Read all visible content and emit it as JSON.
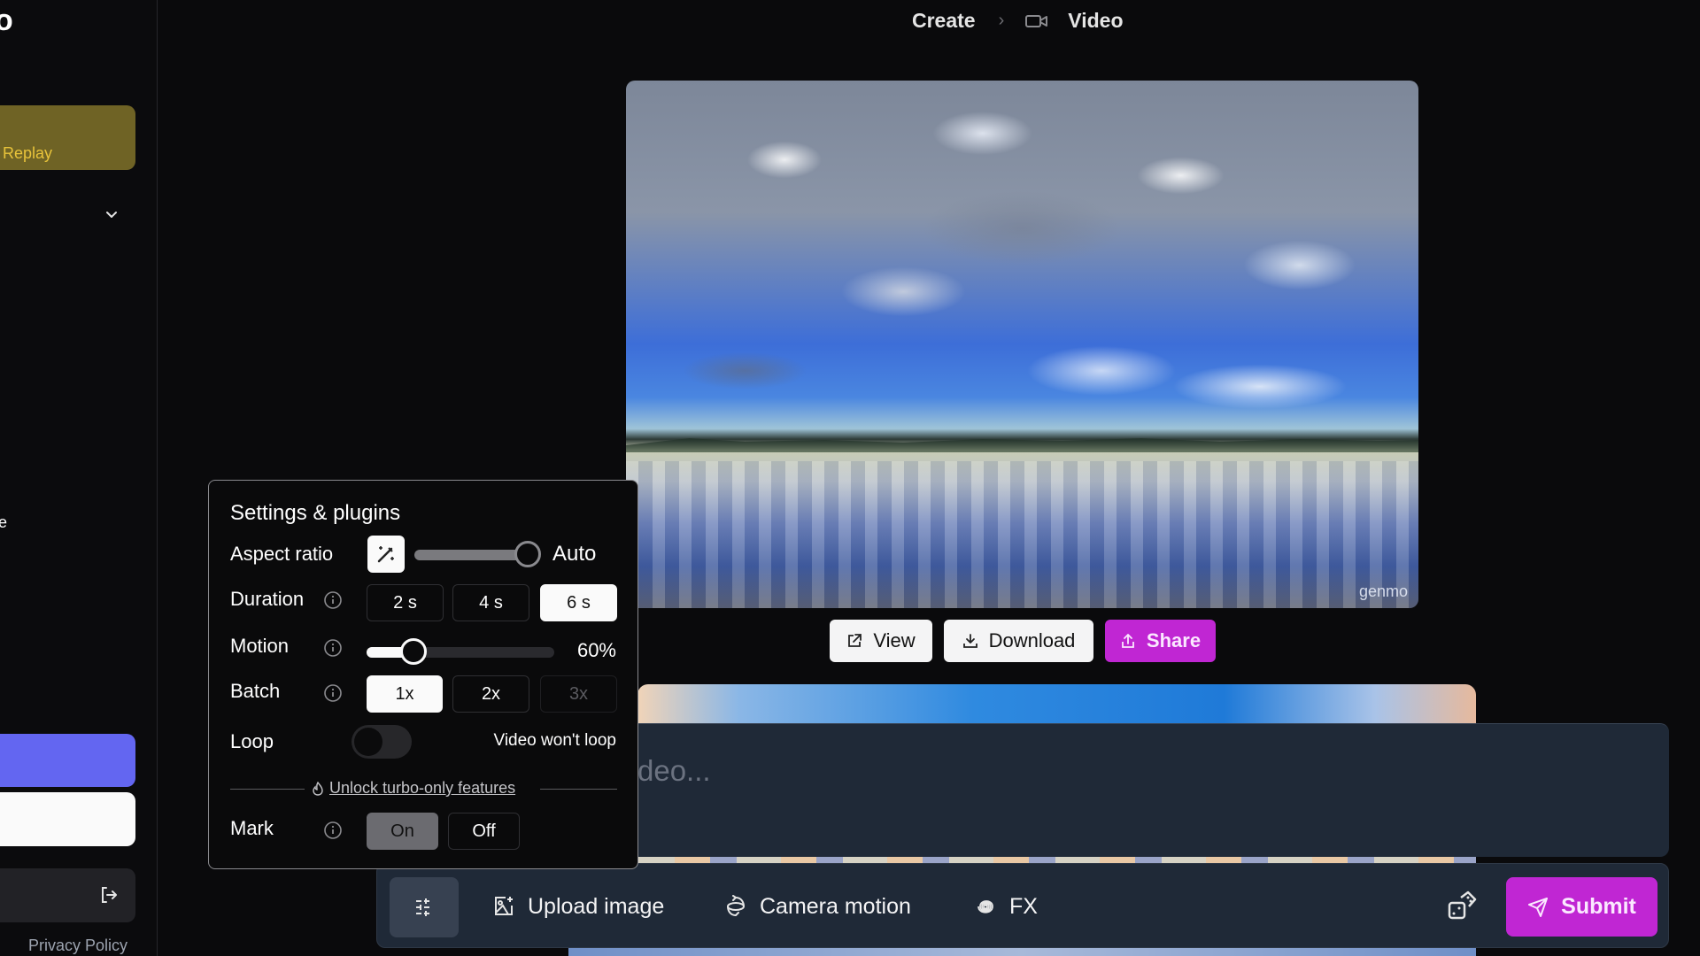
{
  "sidebar": {
    "logo_fragment": "o",
    "replay_label": "Replay",
    "cut_text": "e",
    "privacy_label": "Privacy Policy"
  },
  "breadcrumb": {
    "items": [
      "Create",
      "Video"
    ],
    "separator": "›"
  },
  "video": {
    "watermark": "genmo"
  },
  "actions": {
    "view": "View",
    "download": "Download",
    "share": "Share"
  },
  "prompt": {
    "placeholder_visible": "deo..."
  },
  "toolbar": {
    "upload": "Upload image",
    "camera": "Camera motion",
    "fx": "FX",
    "submit": "Submit"
  },
  "settings": {
    "title": "Settings & plugins",
    "aspect_ratio": {
      "label": "Aspect ratio",
      "value": "Auto",
      "slider_fraction": 1.0
    },
    "duration": {
      "label": "Duration",
      "options": [
        "2 s",
        "4 s",
        "6 s"
      ],
      "selected": "6 s"
    },
    "motion": {
      "label": "Motion",
      "value_label": "60%",
      "slider_fraction": 0.25
    },
    "batch": {
      "label": "Batch",
      "options": [
        "1x",
        "2x",
        "3x"
      ],
      "selected": "1x",
      "disabled": [
        "3x"
      ]
    },
    "loop": {
      "label": "Loop",
      "enabled": false,
      "status": "Video won't loop"
    },
    "turbo_link": "Unlock turbo-only features",
    "mark": {
      "label": "Mark",
      "options": [
        "On",
        "Off"
      ],
      "selected": "On"
    }
  },
  "colors": {
    "accent_magenta": "#c026d3",
    "accent_indigo": "#6366f1",
    "replay_bg": "#6f6325",
    "replay_text": "#e8c33a",
    "panel_bg": "#1f2937"
  }
}
